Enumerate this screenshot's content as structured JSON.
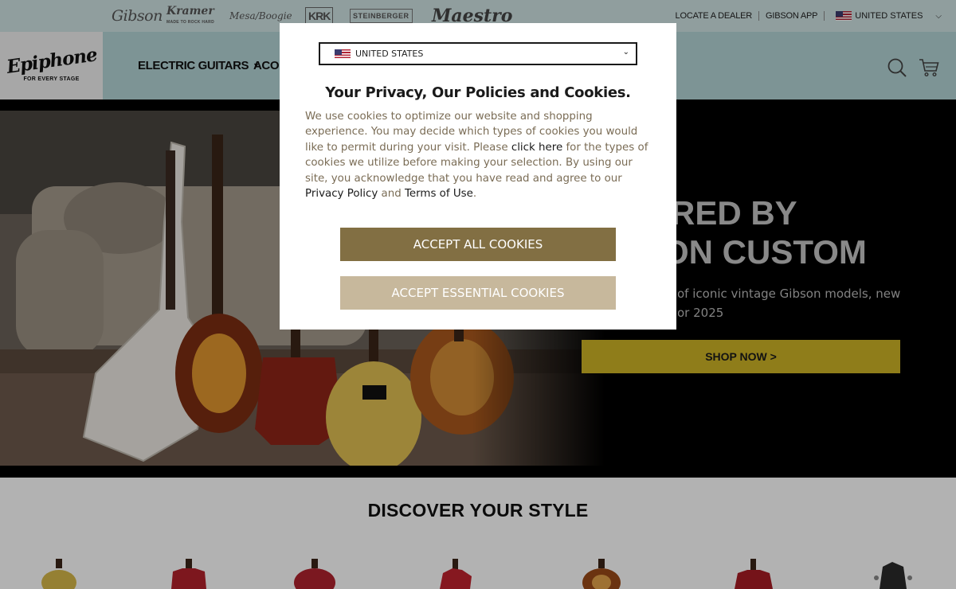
{
  "brand_bar": {
    "brands": {
      "gibson": "Gibson",
      "kramer": "Kramer",
      "kramer_tag": "MADE TO ROCK HARD",
      "mesa_boogie": "Mesa/Boogie",
      "krk": "KRK",
      "steinberger": "STEINBERGER",
      "maestro": "Maestro"
    },
    "locate_dealer": "LOCATE A DEALER",
    "gibson_app": "GIBSON APP",
    "country": "UNITED STATES"
  },
  "nav": {
    "logo_text": "Epiphone",
    "logo_tagline": "FOR EVERY STAGE",
    "electric_guitars": "ELECTRIC GUITARS",
    "acoustic": "ACOU"
  },
  "hero": {
    "title_line1": "RED BY",
    "title_line2": "ON CUSTOM",
    "subtitle_line1": "of iconic vintage Gibson models, new",
    "subtitle_line2": "or 2025",
    "cta": "SHOP NOW >"
  },
  "discover": {
    "title": "DISCOVER YOUR STYLE"
  },
  "cookie_modal": {
    "country_select": "UNITED STATES",
    "title": "Your Privacy, Our Policies and Cookies.",
    "body_part1": "We use cookies to optimize our website and shopping experience. You may decide which types of cookies you would like to permit during your visit. Please ",
    "click_here": "click here",
    "body_part2": " for the types of cookies we utilize before making your selection. By using our site, you acknowledge that you have read and agree to our ",
    "privacy_policy": "Privacy Policy",
    "body_and": " and ",
    "terms_of_use": "Terms of Use",
    "body_end": ".",
    "accept_all": "ACCEPT ALL COOKIES",
    "accept_essential": "ACCEPT ESSENTIAL COOKIES"
  },
  "colors": {
    "brand_bar_bg": "#cfe2e3",
    "nav_bg": "#b4d5d6",
    "hero_bg": "#000000",
    "shop_button": "#cdb326",
    "accept_all": "#826f43",
    "accept_essential": "#c7b89c",
    "modal_text": "#7a6c55"
  }
}
